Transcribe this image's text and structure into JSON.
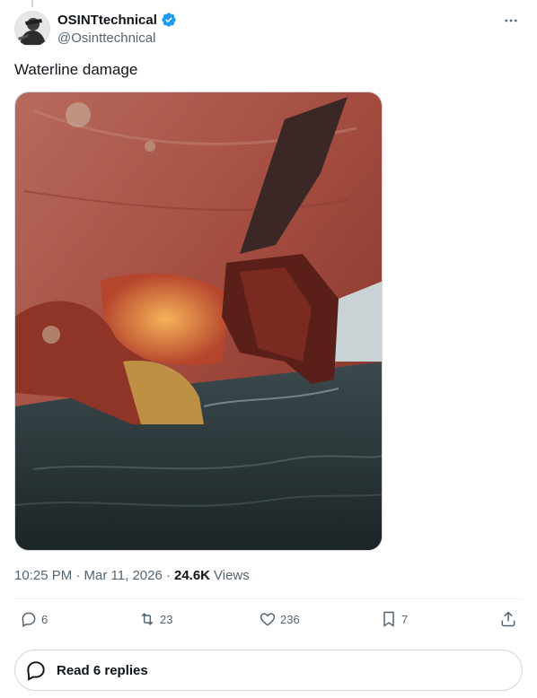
{
  "tweet": {
    "author": {
      "display_name": "OSINTtechnical",
      "handle": "@Osinttechnical",
      "verified": true,
      "avatar_icon": "avatar-photo"
    },
    "more_icon": "more-dots-icon",
    "text": "Waterline damage",
    "media": {
      "type": "photo"
    },
    "timestamp": "10:25 PM · Mar 11, 2026 ·",
    "views_count": "24.6K",
    "views_label": "Views",
    "actions": {
      "replies": "6",
      "retweets": "23",
      "likes": "236",
      "bookmarks": "7"
    },
    "read_replies_label": "Read 6 replies"
  },
  "colors": {
    "verified_blue": "#1d9bf0",
    "secondary_text": "#536471",
    "primary_text": "#0f1419",
    "border": "#cfd9de"
  }
}
